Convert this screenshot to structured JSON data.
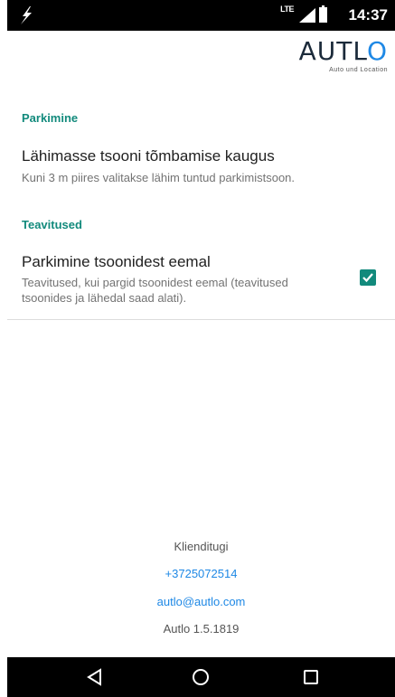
{
  "status_bar": {
    "network_type": "LTE",
    "time": "14:37"
  },
  "header": {
    "logo_prefix": "AUTL",
    "logo_accent": "O",
    "logo_tagline": "Auto und Location"
  },
  "sections": [
    {
      "title": "Parkimine",
      "pref_title": "Lähimasse tsooni tõmbamise kaugus",
      "pref_summary": "Kuni 3 m piires valitakse lähim tuntud parkimistsoon."
    },
    {
      "title": "Teavitused",
      "pref_title": "Parkimine tsoonidest eemal",
      "pref_summary_line1": "Teavitused, kui pargid tsoonidest eemal (teavitused",
      "pref_summary_line2": "tsoonides ja lähedal saad alati).",
      "checked": true
    }
  ],
  "footer": {
    "support_label": "Klienditugi",
    "phone": "+3725072514",
    "email": "autlo@autlo.com",
    "version": "Autlo 1.5.1819"
  },
  "colors": {
    "accent": "#128a7c",
    "link": "#1e88e5",
    "bars": "#000000"
  },
  "icons": [
    "flash-icon",
    "lte-signal-icon",
    "battery-icon",
    "checkmark-icon",
    "back-icon",
    "home-icon",
    "recents-icon"
  ]
}
